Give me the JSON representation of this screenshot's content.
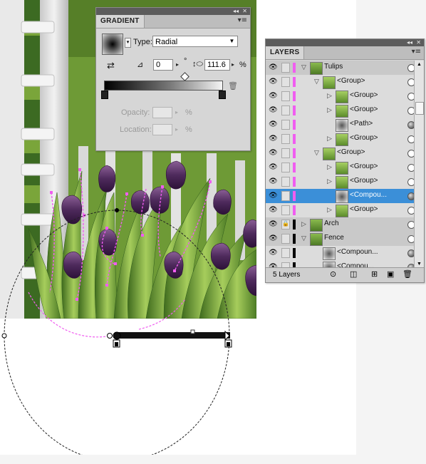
{
  "colors": {
    "highlight": "#f05df0",
    "selection": "#3b8fd8",
    "panel_bg": "#d6d6d6",
    "meadow_green": "#6e9a36",
    "dark_green": "#2f5a1b",
    "tulip_purple": "#5b3565"
  },
  "gradient_panel": {
    "tab_label": "GRADIENT",
    "type_label": "Type:",
    "type_value": "Radial",
    "angle_value": "0",
    "degree_symbol": "°",
    "aspect_value": "111.6",
    "percent": "%",
    "opacity_label": "Opacity:",
    "location_label": "Location:",
    "icons": [
      "gradient-swatch",
      "reverse-gradient-icon",
      "angle-icon",
      "aspect-ratio-icon",
      "delete-stop-icon"
    ]
  },
  "layers_panel": {
    "tab_label": "LAYERS",
    "rows": [
      {
        "label": "Tulips",
        "depth": 0,
        "twisty": "open",
        "color": "#f05df0",
        "type": "layer",
        "target": "hollow",
        "selected_square": true
      },
      {
        "label": "<Group>",
        "depth": 1,
        "twisty": "open",
        "color": "#f05df0",
        "type": "item",
        "target": "hollow",
        "selected_square": false
      },
      {
        "label": "<Group>",
        "depth": 2,
        "twisty": "closed",
        "color": "#f05df0",
        "type": "item",
        "target": "hollow",
        "selected_square": false
      },
      {
        "label": "<Group>",
        "depth": 2,
        "twisty": "closed",
        "color": "#f05df0",
        "type": "item",
        "target": "hollow",
        "selected_square": false
      },
      {
        "label": "<Path>",
        "depth": 2,
        "twisty": "none",
        "color": "#f05df0",
        "type": "item",
        "target": "filled",
        "selected_square": false
      },
      {
        "label": "<Group>",
        "depth": 2,
        "twisty": "closed",
        "color": "#f05df0",
        "type": "item",
        "target": "hollow",
        "selected_square": false
      },
      {
        "label": "<Group>",
        "depth": 1,
        "twisty": "open",
        "color": "#f05df0",
        "type": "item",
        "target": "hollow",
        "selected_square": true
      },
      {
        "label": "<Group>",
        "depth": 2,
        "twisty": "closed",
        "color": "#f05df0",
        "type": "item",
        "target": "hollow",
        "selected_square": false
      },
      {
        "label": "<Group>",
        "depth": 2,
        "twisty": "closed",
        "color": "#f05df0",
        "type": "item",
        "target": "hollow",
        "selected_square": false
      },
      {
        "label": "<Compou...",
        "depth": 2,
        "twisty": "none",
        "color": "#f05df0",
        "type": "selected",
        "target": "filled",
        "selected_square": true
      },
      {
        "label": "<Group>",
        "depth": 2,
        "twisty": "closed",
        "color": "#f05df0",
        "type": "item",
        "target": "hollow",
        "selected_square": false
      },
      {
        "label": "Arch",
        "depth": 0,
        "twisty": "closed",
        "color": "#000000",
        "type": "layer",
        "target": "hollow",
        "selected_square": false,
        "locked": true
      },
      {
        "label": "Fence",
        "depth": 0,
        "twisty": "open",
        "color": "#000000",
        "type": "layer",
        "target": "hollow",
        "selected_square": false
      },
      {
        "label": "<Compoun...",
        "depth": 1,
        "twisty": "none",
        "color": "#000000",
        "type": "item",
        "target": "filled",
        "selected_square": false
      },
      {
        "label": "<Compou...",
        "depth": 1,
        "twisty": "none",
        "color": "#000000",
        "type": "item",
        "target": "filled",
        "selected_square": false
      }
    ],
    "footer": {
      "count_label": "5 Layers",
      "icons": [
        "locate-object-icon",
        "make-clipping-mask-icon",
        "new-sublayer-icon",
        "new-layer-icon",
        "delete-layer-icon"
      ]
    }
  }
}
